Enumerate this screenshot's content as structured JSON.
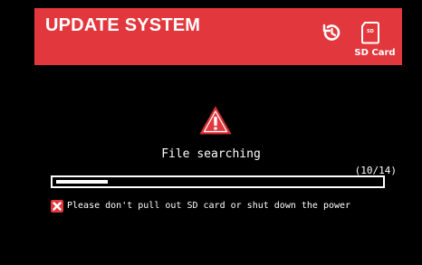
{
  "header": {
    "title": "UPDATE SYSTEM",
    "history_icon": "history-icon",
    "sd_icon": "sd-card-icon",
    "sd_icon_text": "SD",
    "sd_label": "SD Card"
  },
  "status": {
    "icon": "warning-triangle-icon",
    "message": "File searching"
  },
  "progress": {
    "count_label": "(10/14)",
    "fraction": 0.16
  },
  "notice": {
    "icon": "close-x-icon",
    "text": "Please don't pull out SD card or shut down the power"
  },
  "colors": {
    "accent": "#e2383d",
    "background": "#000000",
    "text": "#ffffff"
  }
}
